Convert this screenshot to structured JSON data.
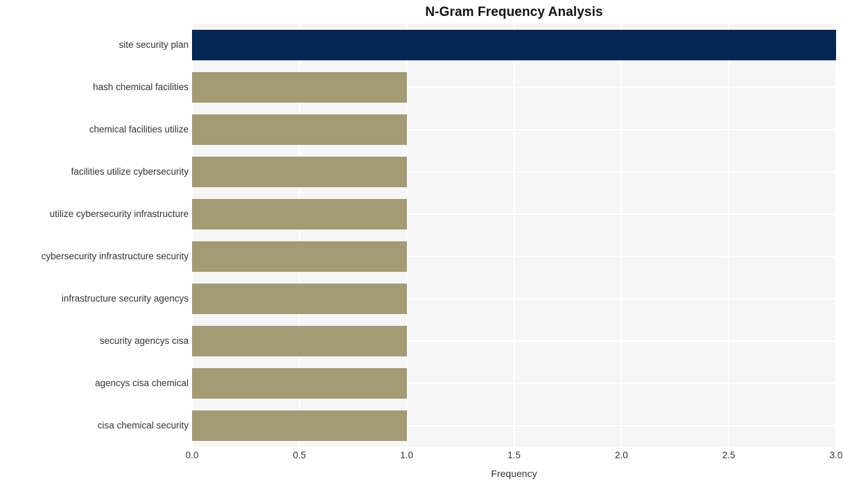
{
  "chart_data": {
    "type": "bar",
    "orientation": "horizontal",
    "title": "N-Gram Frequency Analysis",
    "xlabel": "Frequency",
    "ylabel": "",
    "xlim": [
      0,
      3.0
    ],
    "xticks": [
      "0.0",
      "0.5",
      "1.0",
      "1.5",
      "2.0",
      "2.5",
      "3.0"
    ],
    "xtick_values": [
      0,
      0.5,
      1.0,
      1.5,
      2.0,
      2.5,
      3.0
    ],
    "grid": true,
    "legend": "none",
    "categories": [
      "site security plan",
      "hash chemical facilities",
      "chemical facilities utilize",
      "facilities utilize cybersecurity",
      "utilize cybersecurity infrastructure",
      "cybersecurity infrastructure security",
      "infrastructure security agencys",
      "security agencys cisa",
      "agencys cisa chemical",
      "cisa chemical security"
    ],
    "values": [
      3,
      1,
      1,
      1,
      1,
      1,
      1,
      1,
      1,
      1
    ],
    "bar_colors": [
      "#042754",
      "#a39b73",
      "#a39b73",
      "#a39b73",
      "#a39b73",
      "#a39b73",
      "#a39b73",
      "#a39b73",
      "#a39b73",
      "#a39b73"
    ],
    "plot_background": "#f6f6f7",
    "gridline_color": "#ffffff",
    "figure_background": "#ffffff"
  }
}
